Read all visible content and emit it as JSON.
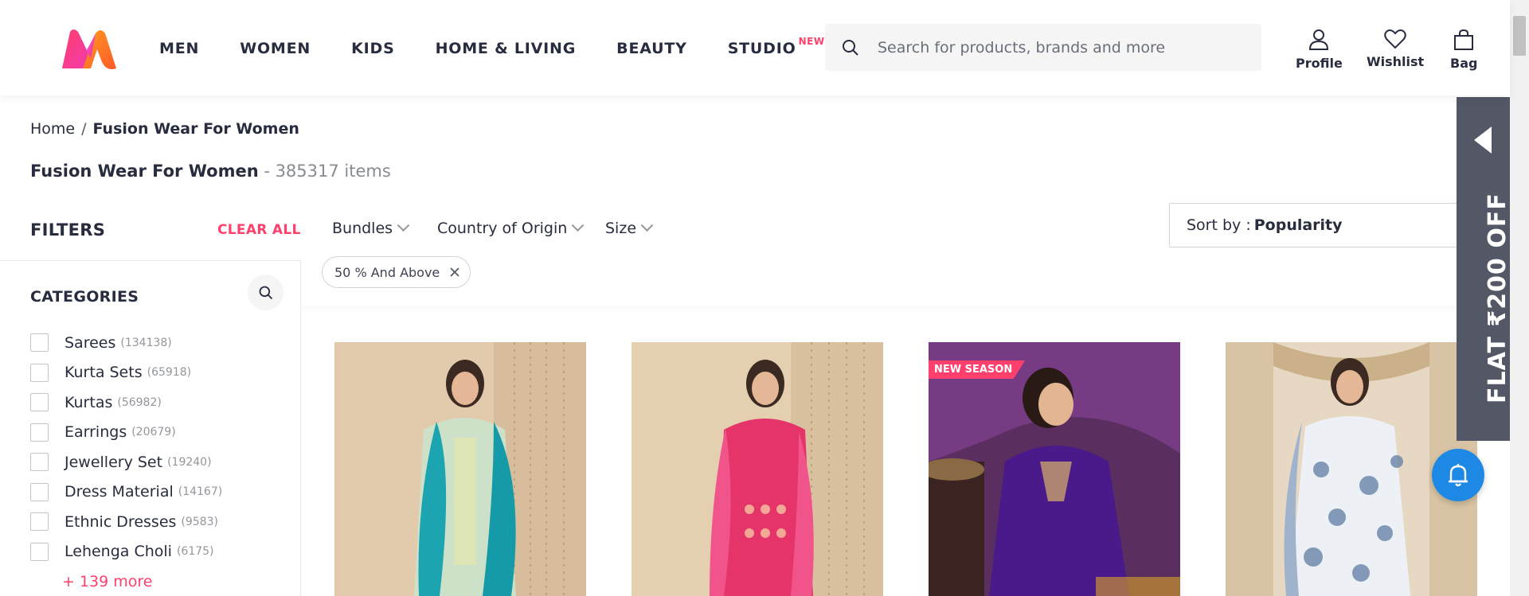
{
  "header": {
    "nav": [
      "MEN",
      "WOMEN",
      "KIDS",
      "HOME & LIVING",
      "BEAUTY",
      "STUDIO"
    ],
    "studio_badge": "NEW",
    "search_placeholder": "Search for products, brands and more",
    "profile": "Profile",
    "wishlist": "Wishlist",
    "bag": "Bag"
  },
  "breadcrumb": {
    "home": "Home",
    "sep": "/",
    "current": "Fusion Wear For Women"
  },
  "page": {
    "title": "Fusion Wear For Women",
    "count": " - 385317 items"
  },
  "filters": {
    "title": "FILTERS",
    "clear_all": "CLEAR ALL",
    "categories_title": "CATEGORIES",
    "categories": [
      {
        "label": "Sarees",
        "count": "(134138)"
      },
      {
        "label": "Kurta Sets",
        "count": "(65918)"
      },
      {
        "label": "Kurtas",
        "count": "(56982)"
      },
      {
        "label": "Earrings",
        "count": "(20679)"
      },
      {
        "label": "Jewellery Set",
        "count": "(19240)"
      },
      {
        "label": "Dress Material",
        "count": "(14167)"
      },
      {
        "label": "Ethnic Dresses",
        "count": "(9583)"
      },
      {
        "label": "Lehenga Choli",
        "count": "(6175)"
      }
    ],
    "more": "+ 139 more"
  },
  "filter_bar": {
    "bundles": "Bundles",
    "country": "Country of Origin",
    "size": "Size",
    "sort_label": "Sort by : ",
    "sort_value": "Popularity",
    "chip": "50 % And Above"
  },
  "products": [
    {
      "badge": ""
    },
    {
      "badge": ""
    },
    {
      "badge": "NEW SEASON"
    },
    {
      "badge": ""
    }
  ],
  "promo": {
    "text": "FLAT ₹200 OFF"
  },
  "colors": {
    "accent": "#ff3f6c",
    "text": "#282c3f",
    "promo_bg": "#535766",
    "bell": "#1e88e5"
  }
}
